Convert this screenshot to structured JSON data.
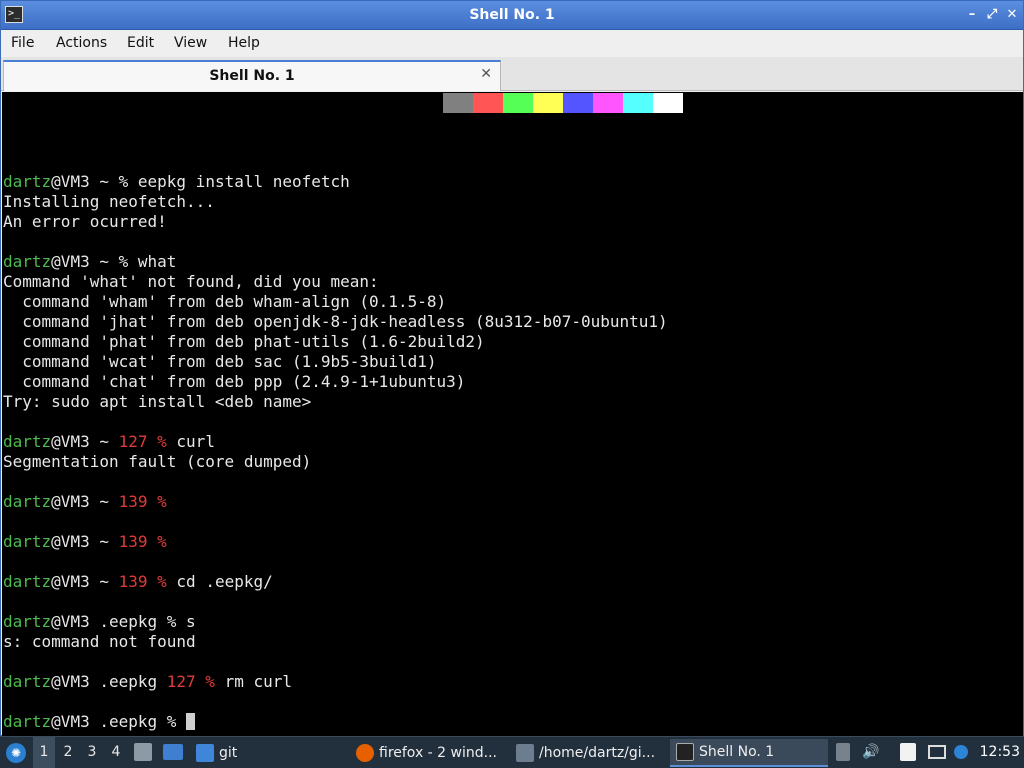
{
  "window": {
    "title": "Shell No. 1"
  },
  "menubar": {
    "items": [
      "File",
      "Actions",
      "Edit",
      "View",
      "Help"
    ]
  },
  "tab": {
    "label": "Shell No. 1"
  },
  "palette": [
    "#808080",
    "#ff5555",
    "#55ff55",
    "#ffff55",
    "#5555ff",
    "#ff55ff",
    "#55ffff",
    "#ffffff"
  ],
  "terminal": {
    "lines": [
      {
        "user": "dartz",
        "host": "@VM3",
        "dir": " ~ ",
        "code": "",
        "prompt": "%",
        "cmd": " eepkg install neofetch",
        "prompt_red": false
      },
      {
        "text": "Installing neofetch..."
      },
      {
        "text": "An error ocurred!"
      },
      {
        "text": ""
      },
      {
        "user": "dartz",
        "host": "@VM3",
        "dir": " ~ ",
        "code": "",
        "prompt": "%",
        "cmd": " what",
        "prompt_red": false
      },
      {
        "text": "Command 'what' not found, did you mean:"
      },
      {
        "text": "  command 'wham' from deb wham-align (0.1.5-8)"
      },
      {
        "text": "  command 'jhat' from deb openjdk-8-jdk-headless (8u312-b07-0ubuntu1)"
      },
      {
        "text": "  command 'phat' from deb phat-utils (1.6-2build2)"
      },
      {
        "text": "  command 'wcat' from deb sac (1.9b5-3build1)"
      },
      {
        "text": "  command 'chat' from deb ppp (2.4.9-1+1ubuntu3)"
      },
      {
        "text": "Try: sudo apt install <deb name>"
      },
      {
        "text": ""
      },
      {
        "user": "dartz",
        "host": "@VM3",
        "dir": " ~ ",
        "code": "127 ",
        "prompt": "%",
        "cmd": " curl",
        "prompt_red": true
      },
      {
        "text": "Segmentation fault (core dumped)"
      },
      {
        "text": ""
      },
      {
        "user": "dartz",
        "host": "@VM3",
        "dir": " ~ ",
        "code": "139 ",
        "prompt": "%",
        "cmd": "",
        "prompt_red": true
      },
      {
        "text": ""
      },
      {
        "user": "dartz",
        "host": "@VM3",
        "dir": " ~ ",
        "code": "139 ",
        "prompt": "%",
        "cmd": "",
        "prompt_red": true
      },
      {
        "text": ""
      },
      {
        "user": "dartz",
        "host": "@VM3",
        "dir": " ~ ",
        "code": "139 ",
        "prompt": "%",
        "cmd": " cd .eepkg/",
        "prompt_red": true
      },
      {
        "text": ""
      },
      {
        "user": "dartz",
        "host": "@VM3",
        "dir": " .eepkg ",
        "code": "",
        "prompt": "%",
        "cmd": " s",
        "prompt_red": false
      },
      {
        "text": "s: command not found"
      },
      {
        "text": ""
      },
      {
        "user": "dartz",
        "host": "@VM3",
        "dir": " .eepkg ",
        "code": "127 ",
        "prompt": "%",
        "cmd": " rm curl",
        "prompt_red": true
      },
      {
        "text": ""
      },
      {
        "user": "dartz",
        "host": "@VM3",
        "dir": " .eepkg ",
        "code": "",
        "prompt": "%",
        "cmd": " ",
        "prompt_red": false,
        "cursor": true
      }
    ]
  },
  "taskbar": {
    "workspaces": [
      "1",
      "2",
      "3",
      "4"
    ],
    "active_workspace": "1",
    "launcher_label": "git",
    "tasks": [
      {
        "label": "firefox - 2 wind...",
        "icon": "firefox-icon",
        "color": "#e66000"
      },
      {
        "label": "/home/dartz/gi...",
        "icon": "text-editor-icon",
        "color": "#6b7d8f"
      },
      {
        "label": "Shell No. 1",
        "icon": "terminal-icon",
        "color": "#222222"
      }
    ],
    "clock": "12:53"
  }
}
